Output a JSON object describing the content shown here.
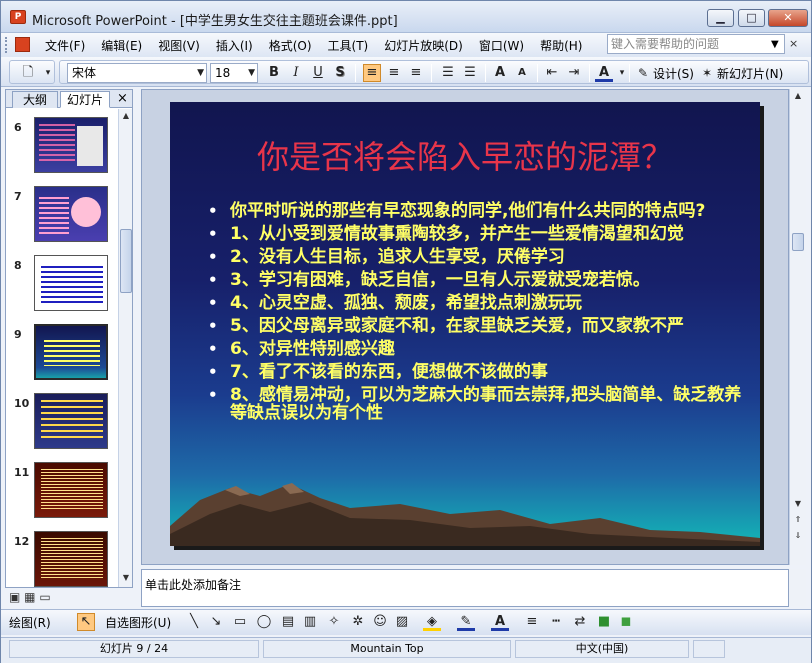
{
  "window": {
    "app_icon_letter": "P",
    "title": "Microsoft PowerPoint - [中学生男女生交往主题班会课件.ppt]",
    "min_btn": "▁",
    "max_btn": "□",
    "close_btn": "✕"
  },
  "menu": {
    "items": [
      "文件(F)",
      "编辑(E)",
      "视图(V)",
      "插入(I)",
      "格式(O)",
      "工具(T)",
      "幻灯片放映(D)",
      "窗口(W)",
      "帮助(H)"
    ],
    "help_placeholder": "键入需要帮助的问题",
    "mdi_close": "× "
  },
  "toolbar": {
    "font_name": "宋体",
    "font_size": "18",
    "bold": "B",
    "italic": "I",
    "underline": "U",
    "shadow": "S",
    "design_label": "设计(S)",
    "new_slide_label": "新幻灯片(N)"
  },
  "left_pane": {
    "tab_outline": "大纲",
    "tab_slides": "幻灯片",
    "close": "×",
    "slides": [
      {
        "num": "6"
      },
      {
        "num": "7"
      },
      {
        "num": "8"
      },
      {
        "num": "9"
      },
      {
        "num": "10"
      },
      {
        "num": "11"
      },
      {
        "num": "12"
      }
    ]
  },
  "slide": {
    "title": "你是否将会陷入早恋的泥潭？",
    "bullets": [
      "你平时听说的那些有早恋现象的同学,他们有什么共同的特点吗?",
      "1、从小受到爱情故事熏陶较多，并产生一些爱情渴望和幻觉",
      "2、没有人生目标，追求人生享受，厌倦学习",
      "3、学习有困难，缺乏自信，一旦有人示爱就受宠若惊。",
      "4、心灵空虚、孤独、颓废，希望找点刺激玩玩",
      "5、因父母离异或家庭不和，在家里缺乏关爱，而又家教不严",
      "6、对异性特别感兴趣",
      "7、看了不该看的东西，便想做不该做的事",
      "8、感情易冲动，可以为芝麻大的事而去崇拜,把头脑简单、缺乏教养等缺点误以为有个性"
    ]
  },
  "notes": {
    "placeholder": "单击此处添加备注"
  },
  "drawing": {
    "draw_label": "绘图(R)",
    "autoshapes_label": "自选图形(U)"
  },
  "status": {
    "slide_pos": "幻灯片 9 / 24",
    "design": "Mountain Top",
    "language": "中文(中国)"
  }
}
